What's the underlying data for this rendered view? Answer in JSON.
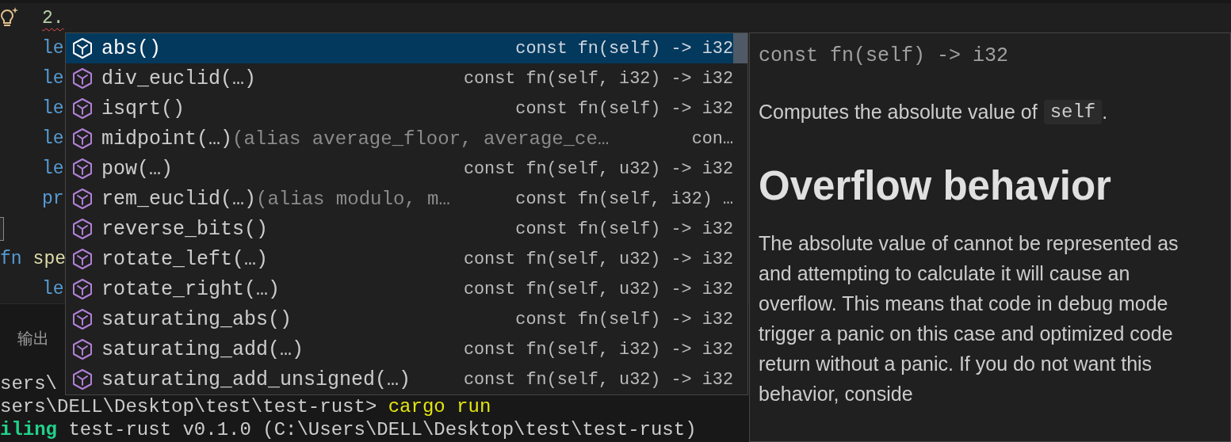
{
  "editor": {
    "lines": [
      {
        "kind": "code",
        "indented": true,
        "squiggle": true,
        "tokens": [
          {
            "text": "2.",
            "kind": "number"
          }
        ]
      },
      {
        "kind": "code",
        "indented": true,
        "squiggle": false,
        "tokens": [
          {
            "text": "le",
            "kind": "keyword"
          }
        ]
      },
      {
        "kind": "code",
        "indented": true,
        "squiggle": false,
        "tokens": [
          {
            "text": "le",
            "kind": "keyword"
          }
        ]
      },
      {
        "kind": "code",
        "indented": true,
        "squiggle": false,
        "tokens": [
          {
            "text": "le",
            "kind": "keyword"
          }
        ]
      },
      {
        "kind": "code",
        "indented": true,
        "squiggle": false,
        "tokens": [
          {
            "text": "le",
            "kind": "keyword"
          }
        ]
      },
      {
        "kind": "code",
        "indented": true,
        "squiggle": false,
        "tokens": [
          {
            "text": "le",
            "kind": "keyword"
          }
        ]
      },
      {
        "kind": "code",
        "indented": true,
        "squiggle": false,
        "tokens": [
          {
            "text": "pr",
            "kind": "keyword"
          }
        ]
      },
      {
        "kind": "bracket_highlight"
      },
      {
        "kind": "code",
        "indented": false,
        "squiggle": false,
        "tokens": [
          {
            "text": "fn",
            "kind": "keyword"
          },
          {
            "text": "spe",
            "kind": "function"
          }
        ]
      },
      {
        "kind": "code",
        "indented": true,
        "squiggle": false,
        "tokens": [
          {
            "text": "le",
            "kind": "keyword"
          }
        ]
      }
    ]
  },
  "panel": {
    "tabs": [
      {
        "label": "输出",
        "selected": false
      }
    ],
    "terminal": [
      [
        {
          "text": "sers\\",
          "kind": "plain"
        }
      ],
      [
        {
          "text": "sers\\DELL\\Desktop\\test\\test-rust> ",
          "kind": "plain"
        },
        {
          "text": "cargo run",
          "kind": "command"
        }
      ],
      [
        {
          "text": "iling",
          "kind": "success"
        },
        {
          "text": " test-rust v0.1.0 (C:\\Users\\DELL\\Desktop\\test\\test-rust)",
          "kind": "plain"
        }
      ]
    ]
  },
  "suggestions": [
    {
      "label": "abs()",
      "detail": "const fn(self) -> i32",
      "selected": true
    },
    {
      "label": "div_euclid(…)",
      "detail": "const fn(self, i32) -> i32",
      "selected": false
    },
    {
      "label": "isqrt()",
      "detail": "const fn(self) -> i32",
      "selected": false
    },
    {
      "label": "midpoint(…)",
      "alias": "(alias average_floor, average_ce…",
      "detail": "con…",
      "selected": false
    },
    {
      "label": "pow(…)",
      "detail": "const fn(self, u32) -> i32",
      "selected": false
    },
    {
      "label": "rem_euclid(…)",
      "alias": "(alias modulo, m…",
      "detail": "const fn(self, i32) …",
      "selected": false
    },
    {
      "label": "reverse_bits()",
      "detail": "const fn(self) -> i32",
      "selected": false
    },
    {
      "label": "rotate_left(…)",
      "detail": "const fn(self, u32) -> i32",
      "selected": false
    },
    {
      "label": "rotate_right(…)",
      "detail": "const fn(self, u32) -> i32",
      "selected": false
    },
    {
      "label": "saturating_abs()",
      "detail": "const fn(self) -> i32",
      "selected": false
    },
    {
      "label": "saturating_add(…)",
      "detail": "const fn(self, i32) -> i32",
      "selected": false
    },
    {
      "label": "saturating_add_unsigned(…)",
      "detail": "const fn(self, u32) -> i32",
      "selected": false
    }
  ],
  "docs": {
    "signature": "const fn(self) -> i32",
    "summary": {
      "text": "Computes the absolute value of",
      "code": "self",
      "after": "."
    },
    "heading": "Overflow behavior",
    "body_lines": [
      "The absolute value of cannot be represented as",
      "and attempting to calculate it will cause an",
      "overflow. This means that code in debug mode",
      "trigger a panic on this case and optimized code",
      "return without a panic. If you do not want this",
      "behavior, conside"
    ]
  }
}
